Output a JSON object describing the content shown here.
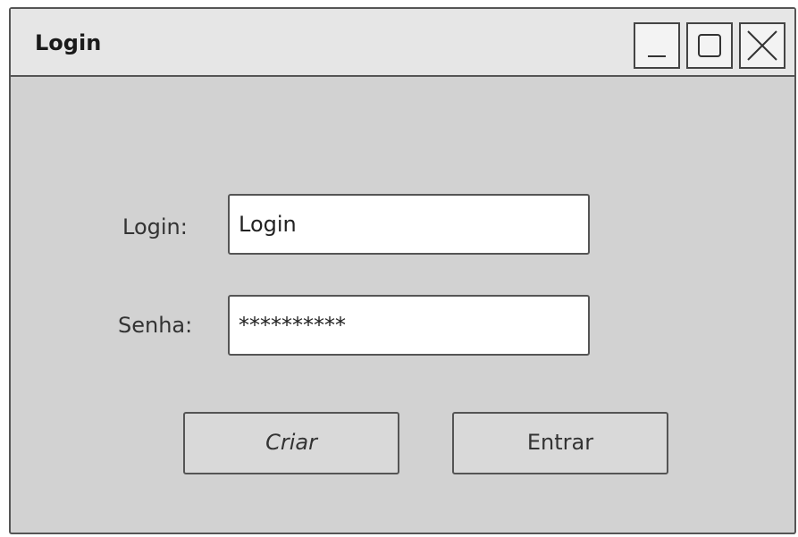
{
  "window": {
    "title": "Login",
    "controls": [
      "minimize-icon",
      "maximize-icon",
      "close-icon"
    ]
  },
  "form": {
    "login_label": "Login:",
    "login_value": "Login",
    "password_label": "Senha:",
    "password_value": "**********"
  },
  "buttons": {
    "create_label": "Criar",
    "submit_label": "Entrar"
  }
}
